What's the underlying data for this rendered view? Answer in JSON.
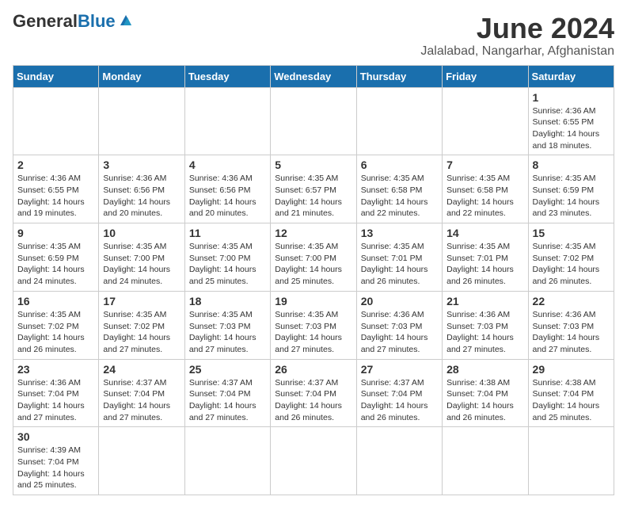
{
  "header": {
    "logo_general": "General",
    "logo_blue": "Blue",
    "title": "June 2024",
    "subtitle": "Jalalabad, Nangarhar, Afghanistan"
  },
  "weekdays": [
    "Sunday",
    "Monday",
    "Tuesday",
    "Wednesday",
    "Thursday",
    "Friday",
    "Saturday"
  ],
  "weeks": [
    [
      {
        "day": "",
        "info": ""
      },
      {
        "day": "",
        "info": ""
      },
      {
        "day": "",
        "info": ""
      },
      {
        "day": "",
        "info": ""
      },
      {
        "day": "",
        "info": ""
      },
      {
        "day": "",
        "info": ""
      },
      {
        "day": "1",
        "info": "Sunrise: 4:36 AM\nSunset: 6:55 PM\nDaylight: 14 hours\nand 18 minutes."
      }
    ],
    [
      {
        "day": "2",
        "info": "Sunrise: 4:36 AM\nSunset: 6:55 PM\nDaylight: 14 hours\nand 19 minutes."
      },
      {
        "day": "3",
        "info": "Sunrise: 4:36 AM\nSunset: 6:56 PM\nDaylight: 14 hours\nand 20 minutes."
      },
      {
        "day": "4",
        "info": "Sunrise: 4:36 AM\nSunset: 6:56 PM\nDaylight: 14 hours\nand 20 minutes."
      },
      {
        "day": "5",
        "info": "Sunrise: 4:35 AM\nSunset: 6:57 PM\nDaylight: 14 hours\nand 21 minutes."
      },
      {
        "day": "6",
        "info": "Sunrise: 4:35 AM\nSunset: 6:58 PM\nDaylight: 14 hours\nand 22 minutes."
      },
      {
        "day": "7",
        "info": "Sunrise: 4:35 AM\nSunset: 6:58 PM\nDaylight: 14 hours\nand 22 minutes."
      },
      {
        "day": "8",
        "info": "Sunrise: 4:35 AM\nSunset: 6:59 PM\nDaylight: 14 hours\nand 23 minutes."
      }
    ],
    [
      {
        "day": "9",
        "info": "Sunrise: 4:35 AM\nSunset: 6:59 PM\nDaylight: 14 hours\nand 24 minutes."
      },
      {
        "day": "10",
        "info": "Sunrise: 4:35 AM\nSunset: 7:00 PM\nDaylight: 14 hours\nand 24 minutes."
      },
      {
        "day": "11",
        "info": "Sunrise: 4:35 AM\nSunset: 7:00 PM\nDaylight: 14 hours\nand 25 minutes."
      },
      {
        "day": "12",
        "info": "Sunrise: 4:35 AM\nSunset: 7:00 PM\nDaylight: 14 hours\nand 25 minutes."
      },
      {
        "day": "13",
        "info": "Sunrise: 4:35 AM\nSunset: 7:01 PM\nDaylight: 14 hours\nand 26 minutes."
      },
      {
        "day": "14",
        "info": "Sunrise: 4:35 AM\nSunset: 7:01 PM\nDaylight: 14 hours\nand 26 minutes."
      },
      {
        "day": "15",
        "info": "Sunrise: 4:35 AM\nSunset: 7:02 PM\nDaylight: 14 hours\nand 26 minutes."
      }
    ],
    [
      {
        "day": "16",
        "info": "Sunrise: 4:35 AM\nSunset: 7:02 PM\nDaylight: 14 hours\nand 26 minutes."
      },
      {
        "day": "17",
        "info": "Sunrise: 4:35 AM\nSunset: 7:02 PM\nDaylight: 14 hours\nand 27 minutes."
      },
      {
        "day": "18",
        "info": "Sunrise: 4:35 AM\nSunset: 7:03 PM\nDaylight: 14 hours\nand 27 minutes."
      },
      {
        "day": "19",
        "info": "Sunrise: 4:35 AM\nSunset: 7:03 PM\nDaylight: 14 hours\nand 27 minutes."
      },
      {
        "day": "20",
        "info": "Sunrise: 4:36 AM\nSunset: 7:03 PM\nDaylight: 14 hours\nand 27 minutes."
      },
      {
        "day": "21",
        "info": "Sunrise: 4:36 AM\nSunset: 7:03 PM\nDaylight: 14 hours\nand 27 minutes."
      },
      {
        "day": "22",
        "info": "Sunrise: 4:36 AM\nSunset: 7:03 PM\nDaylight: 14 hours\nand 27 minutes."
      }
    ],
    [
      {
        "day": "23",
        "info": "Sunrise: 4:36 AM\nSunset: 7:04 PM\nDaylight: 14 hours\nand 27 minutes."
      },
      {
        "day": "24",
        "info": "Sunrise: 4:37 AM\nSunset: 7:04 PM\nDaylight: 14 hours\nand 27 minutes."
      },
      {
        "day": "25",
        "info": "Sunrise: 4:37 AM\nSunset: 7:04 PM\nDaylight: 14 hours\nand 27 minutes."
      },
      {
        "day": "26",
        "info": "Sunrise: 4:37 AM\nSunset: 7:04 PM\nDaylight: 14 hours\nand 26 minutes."
      },
      {
        "day": "27",
        "info": "Sunrise: 4:37 AM\nSunset: 7:04 PM\nDaylight: 14 hours\nand 26 minutes."
      },
      {
        "day": "28",
        "info": "Sunrise: 4:38 AM\nSunset: 7:04 PM\nDaylight: 14 hours\nand 26 minutes."
      },
      {
        "day": "29",
        "info": "Sunrise: 4:38 AM\nSunset: 7:04 PM\nDaylight: 14 hours\nand 25 minutes."
      }
    ],
    [
      {
        "day": "30",
        "info": "Sunrise: 4:39 AM\nSunset: 7:04 PM\nDaylight: 14 hours\nand 25 minutes."
      },
      {
        "day": "",
        "info": ""
      },
      {
        "day": "",
        "info": ""
      },
      {
        "day": "",
        "info": ""
      },
      {
        "day": "",
        "info": ""
      },
      {
        "day": "",
        "info": ""
      },
      {
        "day": "",
        "info": ""
      }
    ]
  ]
}
